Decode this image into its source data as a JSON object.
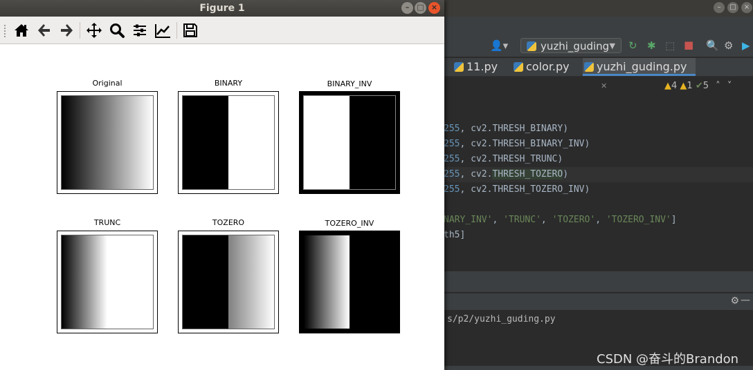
{
  "figure": {
    "title": "Figure 1",
    "toolbar": [
      {
        "icon": "home-icon"
      },
      {
        "icon": "back-arrow-icon"
      },
      {
        "icon": "forward-arrow-icon"
      },
      {
        "icon": "pan-move-icon"
      },
      {
        "icon": "zoom-magnifier-icon"
      },
      {
        "icon": "subplots-config-icon"
      },
      {
        "icon": "edit-axes-icon"
      },
      {
        "icon": "save-floppy-icon"
      }
    ],
    "subplots": [
      {
        "title": "Original"
      },
      {
        "title": "BINARY"
      },
      {
        "title": "BINARY_INV"
      },
      {
        "title": "TRUNC"
      },
      {
        "title": "TOZERO"
      },
      {
        "title": "TOZERO_INV"
      }
    ]
  },
  "ide": {
    "run_config": "yuzhi_guding",
    "tabs": [
      "11.py",
      "color.py",
      "yuzhi_guding.py"
    ],
    "inspections": {
      "warnings": "4",
      "errors": "1",
      "weak": "5"
    },
    "code_lines": [
      {
        "num": "255",
        "rest": ", cv2.THRESH_BINARY)"
      },
      {
        "num": "255",
        "rest": ", cv2.THRESH_BINARY_INV)"
      },
      {
        "num": "255",
        "rest": ", cv2.THRESH_TRUNC)"
      },
      {
        "num": "255",
        "rest_a": ", cv2.",
        "rest_hl": "THRESH_TOZERO",
        "rest_b": ")"
      },
      {
        "num": "255",
        "rest": ", cv2.THRESH_TOZERO_INV)"
      }
    ],
    "code_titles_line": {
      "a": "NARY_INV'",
      "b": ", ",
      "c": "'TRUNC'",
      "d": ", ",
      "e": "'TOZERO'",
      "f": ", ",
      "g": "'TOZERO_INV'",
      "h": "]"
    },
    "code_images_line": "th5]",
    "run_output": "s/p2/yuzhi_guding.py",
    "watermark": "CSDN @奋斗的Brandon"
  }
}
